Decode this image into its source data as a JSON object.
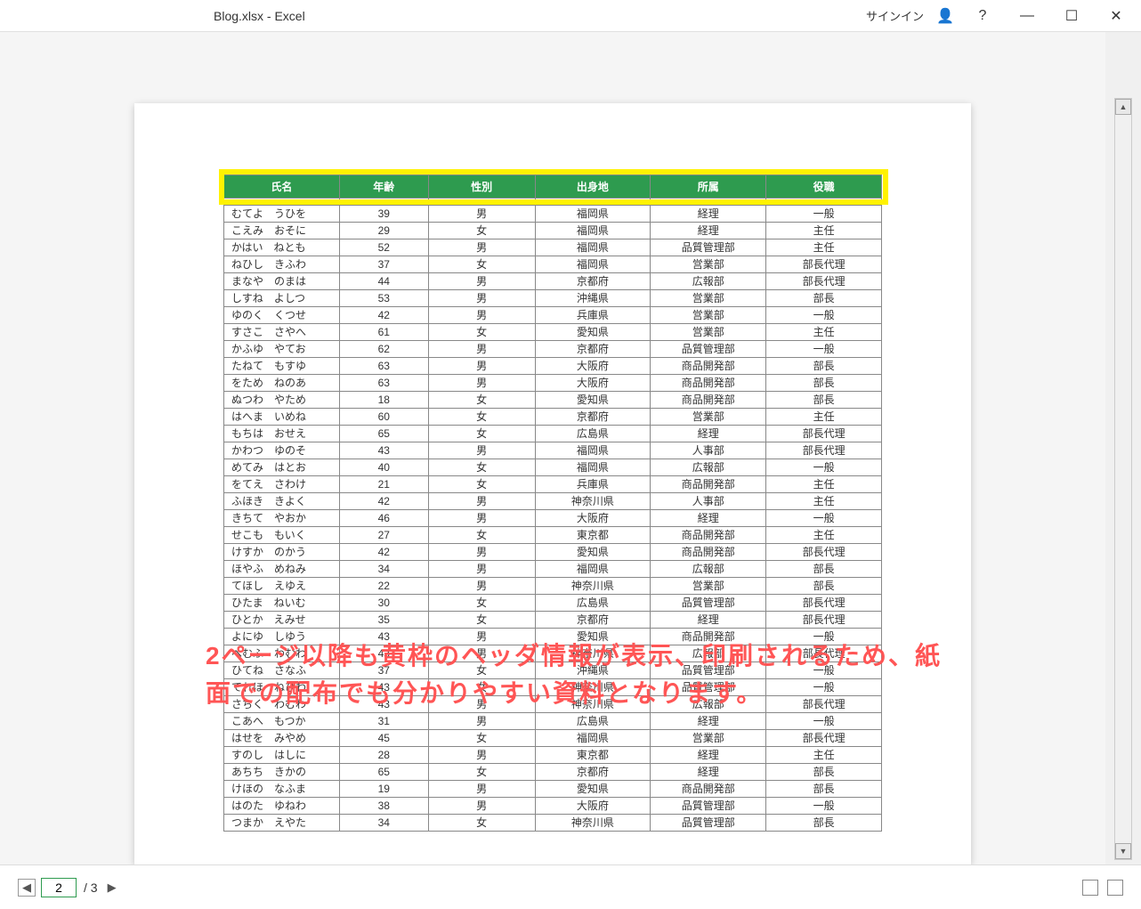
{
  "titlebar": {
    "title": "Blog.xlsx  -  Excel",
    "signin": "サインイン"
  },
  "table": {
    "headers": [
      "氏名",
      "年齢",
      "性別",
      "出身地",
      "所属",
      "役職"
    ],
    "partial_row": [
      "",
      "",
      "",
      "",
      "",
      ""
    ],
    "rows": [
      [
        "むてよ　うひを",
        "39",
        "男",
        "福岡県",
        "経理",
        "一般"
      ],
      [
        "こえみ　おそに",
        "29",
        "女",
        "福岡県",
        "経理",
        "主任"
      ],
      [
        "かはい　ねとも",
        "52",
        "男",
        "福岡県",
        "品質管理部",
        "主任"
      ],
      [
        "ねひし　きふわ",
        "37",
        "女",
        "福岡県",
        "営業部",
        "部長代理"
      ],
      [
        "まなや　のまは",
        "44",
        "男",
        "京都府",
        "広報部",
        "部長代理"
      ],
      [
        "しすね　よしつ",
        "53",
        "男",
        "沖縄県",
        "営業部",
        "部長"
      ],
      [
        "ゆのく　くつせ",
        "42",
        "男",
        "兵庫県",
        "営業部",
        "一般"
      ],
      [
        "すさこ　さやへ",
        "61",
        "女",
        "愛知県",
        "営業部",
        "主任"
      ],
      [
        "かふゆ　やてお",
        "62",
        "男",
        "京都府",
        "品質管理部",
        "一般"
      ],
      [
        "たねて　もすゆ",
        "63",
        "男",
        "大阪府",
        "商品開発部",
        "部長"
      ],
      [
        "をため　ねのあ",
        "63",
        "男",
        "大阪府",
        "商品開発部",
        "部長"
      ],
      [
        "ぬつわ　やため",
        "18",
        "女",
        "愛知県",
        "商品開発部",
        "部長"
      ],
      [
        "はへま　いめね",
        "60",
        "女",
        "京都府",
        "営業部",
        "主任"
      ],
      [
        "もちは　おせえ",
        "65",
        "女",
        "広島県",
        "経理",
        "部長代理"
      ],
      [
        "かわつ　ゆのそ",
        "43",
        "男",
        "福岡県",
        "人事部",
        "部長代理"
      ],
      [
        "めてみ　はとお",
        "40",
        "女",
        "福岡県",
        "広報部",
        "一般"
      ],
      [
        "をてえ　さわけ",
        "21",
        "女",
        "兵庫県",
        "商品開発部",
        "主任"
      ],
      [
        "ふほき　きよく",
        "42",
        "男",
        "神奈川県",
        "人事部",
        "主任"
      ],
      [
        "きちて　やおか",
        "46",
        "男",
        "大阪府",
        "経理",
        "一般"
      ],
      [
        "せこも　もいく",
        "27",
        "女",
        "東京都",
        "商品開発部",
        "主任"
      ],
      [
        "けすか　のかう",
        "42",
        "男",
        "愛知県",
        "商品開発部",
        "部長代理"
      ],
      [
        "ほやふ　めねみ",
        "34",
        "男",
        "福岡県",
        "広報部",
        "部長"
      ],
      [
        "てほし　えゆえ",
        "22",
        "男",
        "神奈川県",
        "営業部",
        "部長"
      ],
      [
        "ひたま　ねいむ",
        "30",
        "女",
        "広島県",
        "品質管理部",
        "部長代理"
      ],
      [
        "ひとか　えみせ",
        "35",
        "女",
        "京都府",
        "経理",
        "部長代理"
      ],
      [
        "よにゆ　しゆう",
        "43",
        "男",
        "愛知県",
        "商品開発部",
        "一般"
      ],
      [
        "へむふ　わむわ",
        "43",
        "男",
        "神奈川県",
        "広報部",
        "部長代理"
      ],
      [
        "ひてね　さなふ",
        "37",
        "女",
        "沖縄県",
        "品質管理部",
        "一般"
      ],
      [
        "てれほ　ねひわ",
        "43",
        "女",
        "神奈川県",
        "品質管理部",
        "一般"
      ],
      [
        "さちく　わむわ",
        "43",
        "男",
        "神奈川県",
        "広報部",
        "部長代理"
      ],
      [
        "こあへ　もつか",
        "31",
        "男",
        "広島県",
        "経理",
        "一般"
      ],
      [
        "はせを　みやめ",
        "45",
        "女",
        "福岡県",
        "営業部",
        "部長代理"
      ],
      [
        "すのし　はしに",
        "28",
        "男",
        "東京都",
        "経理",
        "主任"
      ],
      [
        "あちち　きかの",
        "65",
        "女",
        "京都府",
        "経理",
        "部長"
      ],
      [
        "けほの　なふま",
        "19",
        "男",
        "愛知県",
        "商品開発部",
        "部長"
      ],
      [
        "はのた　ゆねわ",
        "38",
        "男",
        "大阪府",
        "品質管理部",
        "一般"
      ],
      [
        "つまか　えやた",
        "34",
        "女",
        "神奈川県",
        "品質管理部",
        "部長"
      ]
    ]
  },
  "overlay": {
    "text": "2ページ以降も黄枠のヘッダ情報が表示、印刷されるため、紙面での配布でも分かりやすい資料となります。"
  },
  "pagination": {
    "current": "2",
    "total": "/ 3"
  }
}
